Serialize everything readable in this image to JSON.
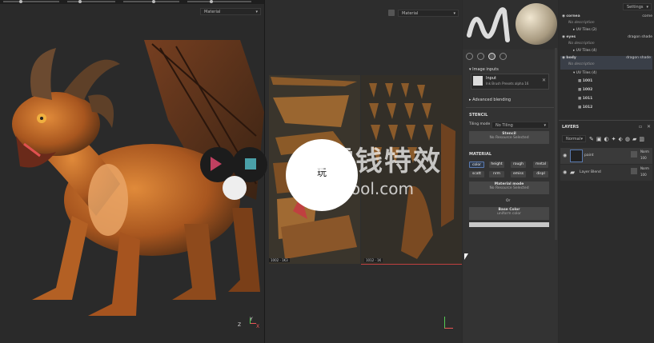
{
  "viewport3d": {
    "dropdown_value": "Material",
    "axis_labels": {
      "z": "Z",
      "y": "Y",
      "x": "X"
    }
  },
  "viewport2d": {
    "dropdown_value": "Material",
    "uv_label_left": "1002 · 1K3",
    "uv_label_right": "1012 · 1K"
  },
  "properties": {
    "image_inputs_title": "Image inputs",
    "input_name": "Input",
    "input_desc": "Ink Brush Presets alpha 16",
    "advanced_blending": "Advanced blending",
    "stencil_title": "STENCIL",
    "tiling_label": "Tiling mode",
    "tiling_value": "No Tiling",
    "stencil_button": "Stencil",
    "stencil_sub": "No Resource Selected",
    "material_title": "MATERIAL",
    "channels": [
      "color",
      "height",
      "rough",
      "metal",
      "nrm",
      "emiss",
      "displ"
    ],
    "scatter_label": "scatt",
    "material_mode": "Material mode",
    "material_mode_sub": "No Resource Selected",
    "or_label": "Or",
    "base_color": "Base Color",
    "base_color_sub": "uniform color"
  },
  "right_panel": {
    "settings_label": "Settings",
    "tree": [
      {
        "name": "cornea",
        "right": "corne",
        "desc": "No description",
        "uv": "UV Tiles (2)"
      },
      {
        "name": "eyes",
        "right": "dragon shade",
        "desc": "No description",
        "uv": "UV Tiles (4)"
      },
      {
        "name": "body",
        "right": "dragon shade",
        "desc": "No description",
        "uv": "UV Tiles (4)"
      }
    ],
    "tiles": [
      "1001",
      "1002",
      "1011",
      "1012"
    ],
    "layers_title": "LAYERS",
    "blend_mode": "Normal",
    "layers": [
      {
        "name": "paint",
        "mode": "Norm",
        "opacity": "100"
      },
      {
        "name": "Layer Blend",
        "mode": "Norm",
        "opacity": "100"
      }
    ]
  },
  "watermark": {
    "cn_text": "三零钱特效",
    "url": "wfxcool.com",
    "play_label": "玩"
  }
}
